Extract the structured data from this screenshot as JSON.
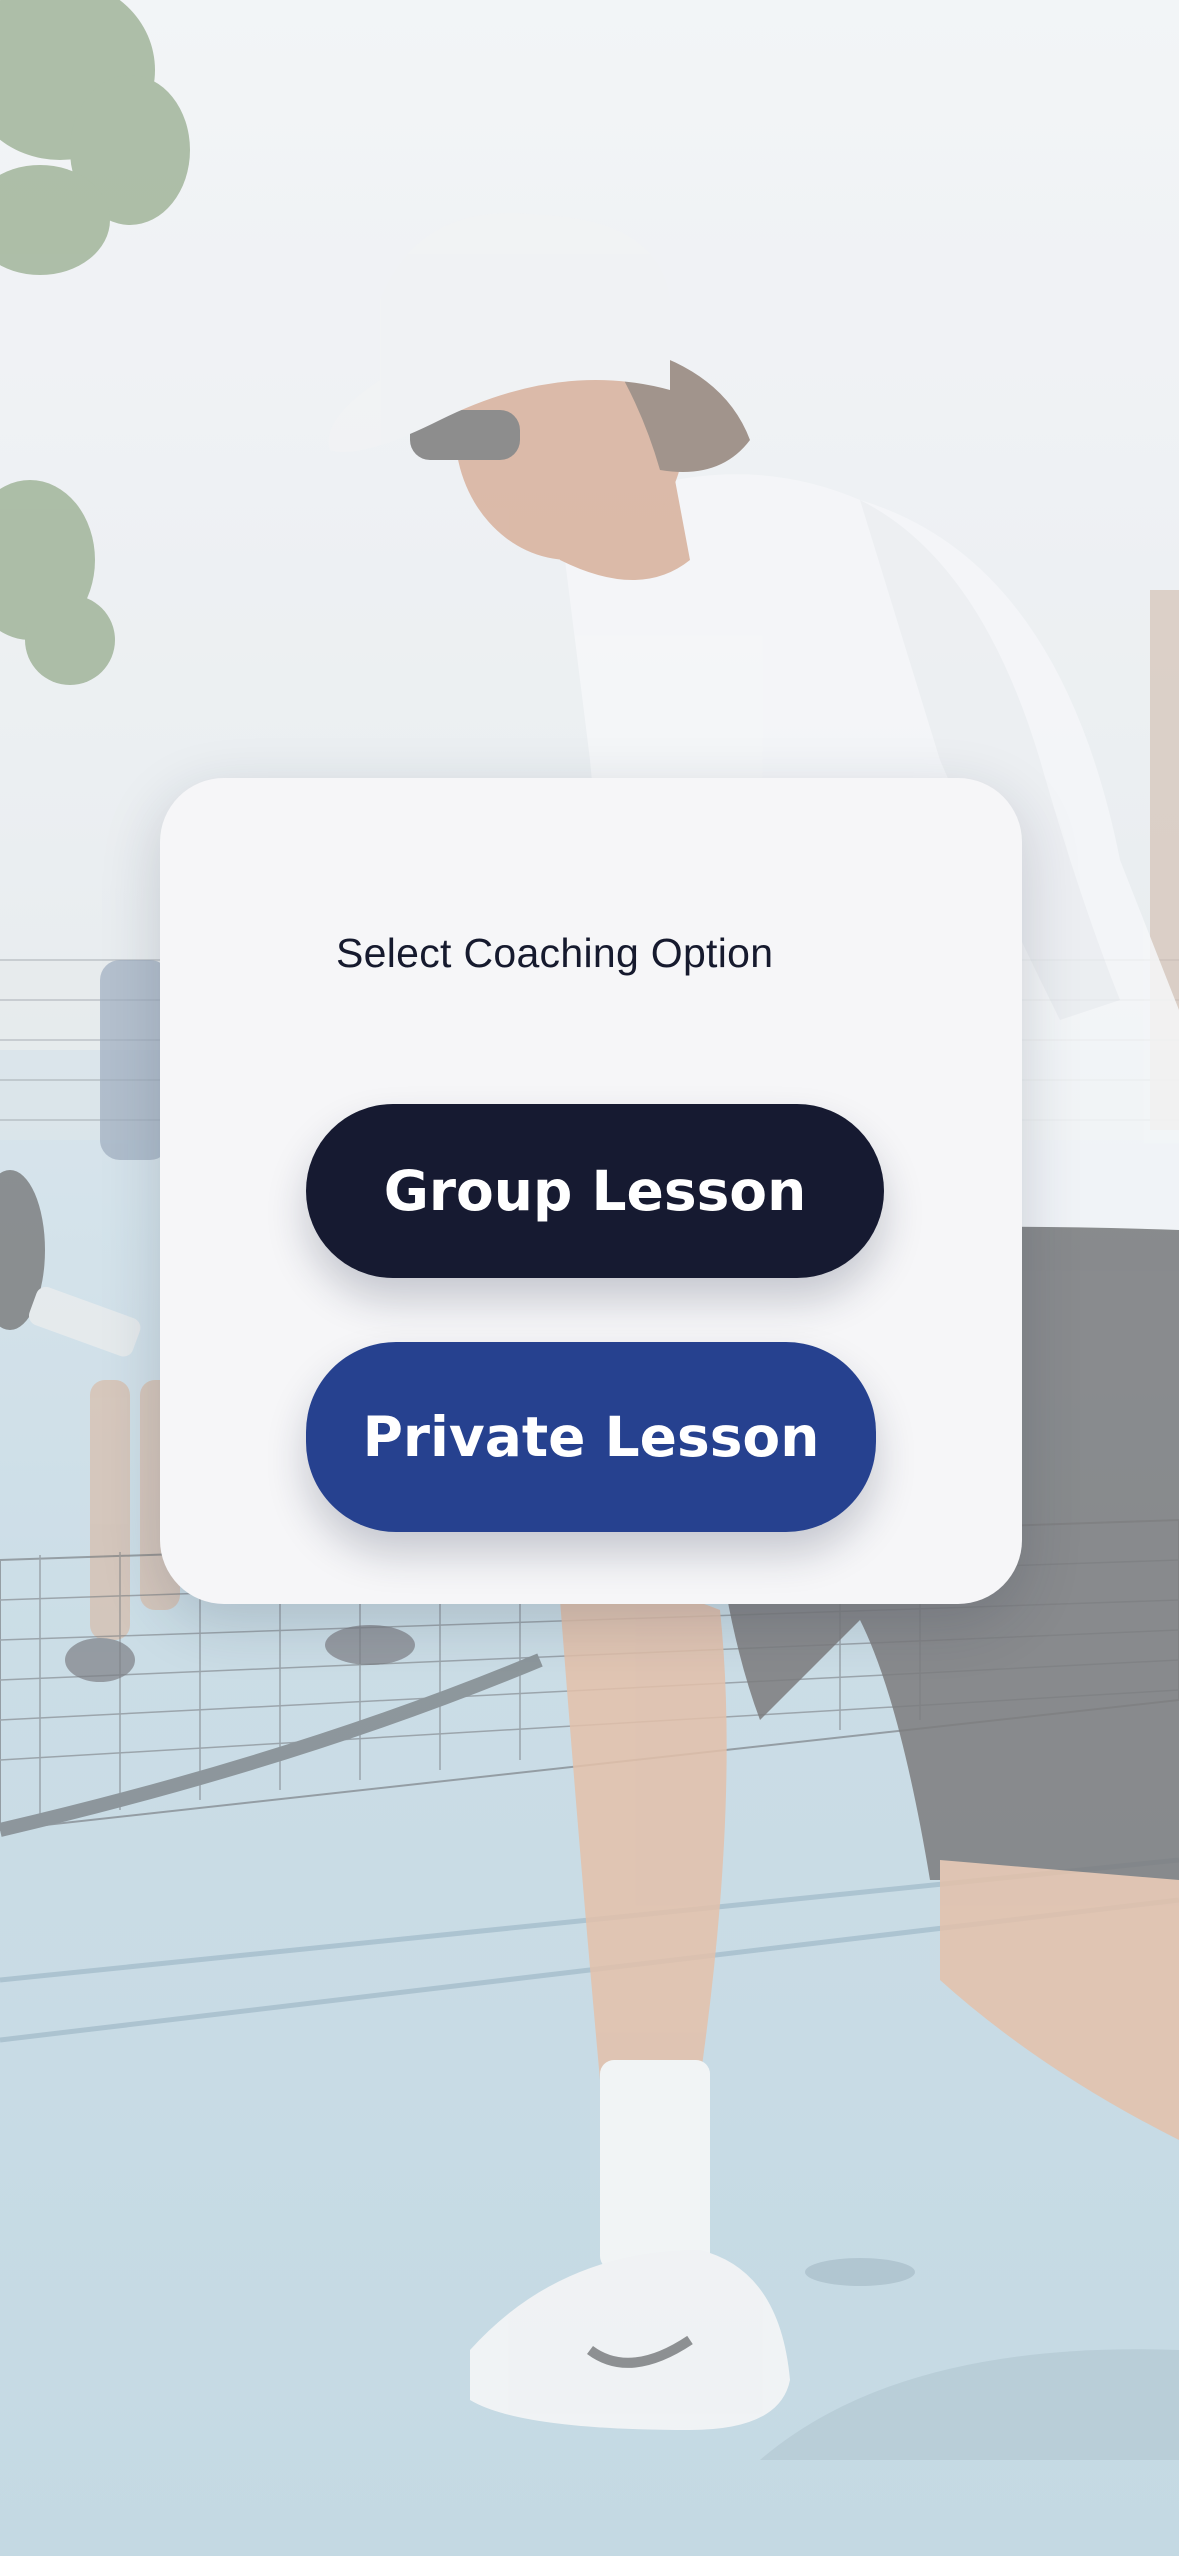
{
  "modal": {
    "title": "Select Coaching Option",
    "buttons": {
      "group_label": "Group Lesson",
      "private_label": "Private Lesson"
    }
  },
  "colors": {
    "group_button": "#161a31",
    "private_button": "#26418f",
    "card_background": "#f6f6f8",
    "title_text": "#161a2e"
  }
}
